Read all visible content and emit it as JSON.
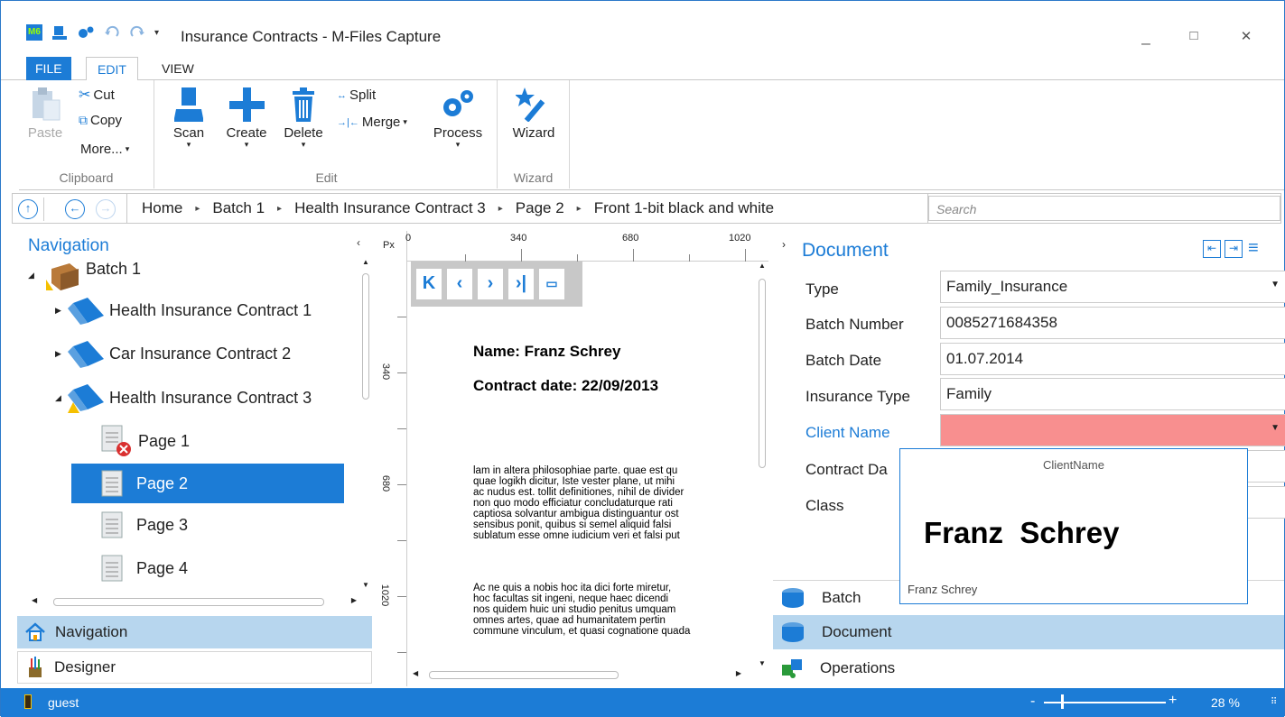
{
  "window": {
    "title": "Insurance Contracts - M-Files Capture",
    "minimize": "_",
    "maximize": "□",
    "close": "✕"
  },
  "ribbon_tabs": [
    "FILE",
    "EDIT",
    "VIEW"
  ],
  "ribbon": {
    "clipboard": {
      "paste": "Paste",
      "cut": "Cut",
      "copy": "Copy",
      "more": "More...",
      "label": "Clipboard"
    },
    "edit": {
      "scan": "Scan",
      "create": "Create",
      "delete": "Delete",
      "split": "Split",
      "merge": "Merge",
      "process": "Process",
      "label": "Edit"
    },
    "wizard": {
      "wizard": "Wizard",
      "label": "Wizard"
    }
  },
  "breadcrumb": [
    "Home",
    "Batch 1",
    "Health Insurance Contract 3",
    "Page 2",
    "Front 1-bit black and white"
  ],
  "search": {
    "placeholder": "Search"
  },
  "navigation": {
    "title": "Navigation",
    "tree": [
      {
        "label": "Batch 1"
      },
      {
        "label": "Health Insurance Contract 1"
      },
      {
        "label": "Car Insurance Contract 2"
      },
      {
        "label": "Health Insurance Contract 3"
      },
      {
        "label": "Page 1"
      },
      {
        "label": "Page 2"
      },
      {
        "label": "Page 3"
      },
      {
        "label": "Page 4"
      }
    ],
    "panes": [
      "Navigation",
      "Designer"
    ]
  },
  "viewer": {
    "ruler_unit": "Px",
    "h_ticks": [
      "0",
      "340",
      "680",
      "1020"
    ],
    "v_ticks": [
      "340",
      "680",
      "1020"
    ],
    "heading_name": "Name: Franz Schrey",
    "heading_date": "Contract date: 22/09/2013",
    "paragraph1": [
      "lam in altera philosophiae parte. quae est qu",
      "quae logikh dicitur, Iste vester plane, ut mihi",
      "ac nudus est. tollit definitiones, nihil de divider",
      "non quo modo efficiatur concludaturque rati",
      "captiosa solvantur ambigua distinguantur ost",
      "sensibus ponit, quibus si semel aliquid falsi",
      "sublatum esse omne iudicium veri et falsi put"
    ],
    "paragraph2": [
      "Ac ne quis a nobis hoc ita dici forte miretur,",
      "hoc facultas sit ingeni, neque haec dicendi",
      "nos quidem huic uni studio penitus umquam",
      "omnes artes, quae ad humanitatem pertin",
      "commune vinculum, et quasi cognatione quada"
    ]
  },
  "document": {
    "title": "Document",
    "fields": [
      {
        "label": "Type",
        "value": "Family_Insurance"
      },
      {
        "label": "Batch Number",
        "value": "0085271684358"
      },
      {
        "label": "Batch Date",
        "value": "01.07.2014"
      },
      {
        "label": "Insurance Type",
        "value": "Family"
      },
      {
        "label": "Client Name",
        "value": ""
      },
      {
        "label": "Contract Da",
        "value": ""
      },
      {
        "label": "Class",
        "value": ""
      }
    ],
    "popup": {
      "field": "ClientName",
      "snippet": "Franz  Schrey",
      "recognized": "Franz Schrey"
    },
    "sections": [
      "Batch",
      "Document",
      "Operations"
    ]
  },
  "status": {
    "user": "guest",
    "zoom": "28 %"
  }
}
